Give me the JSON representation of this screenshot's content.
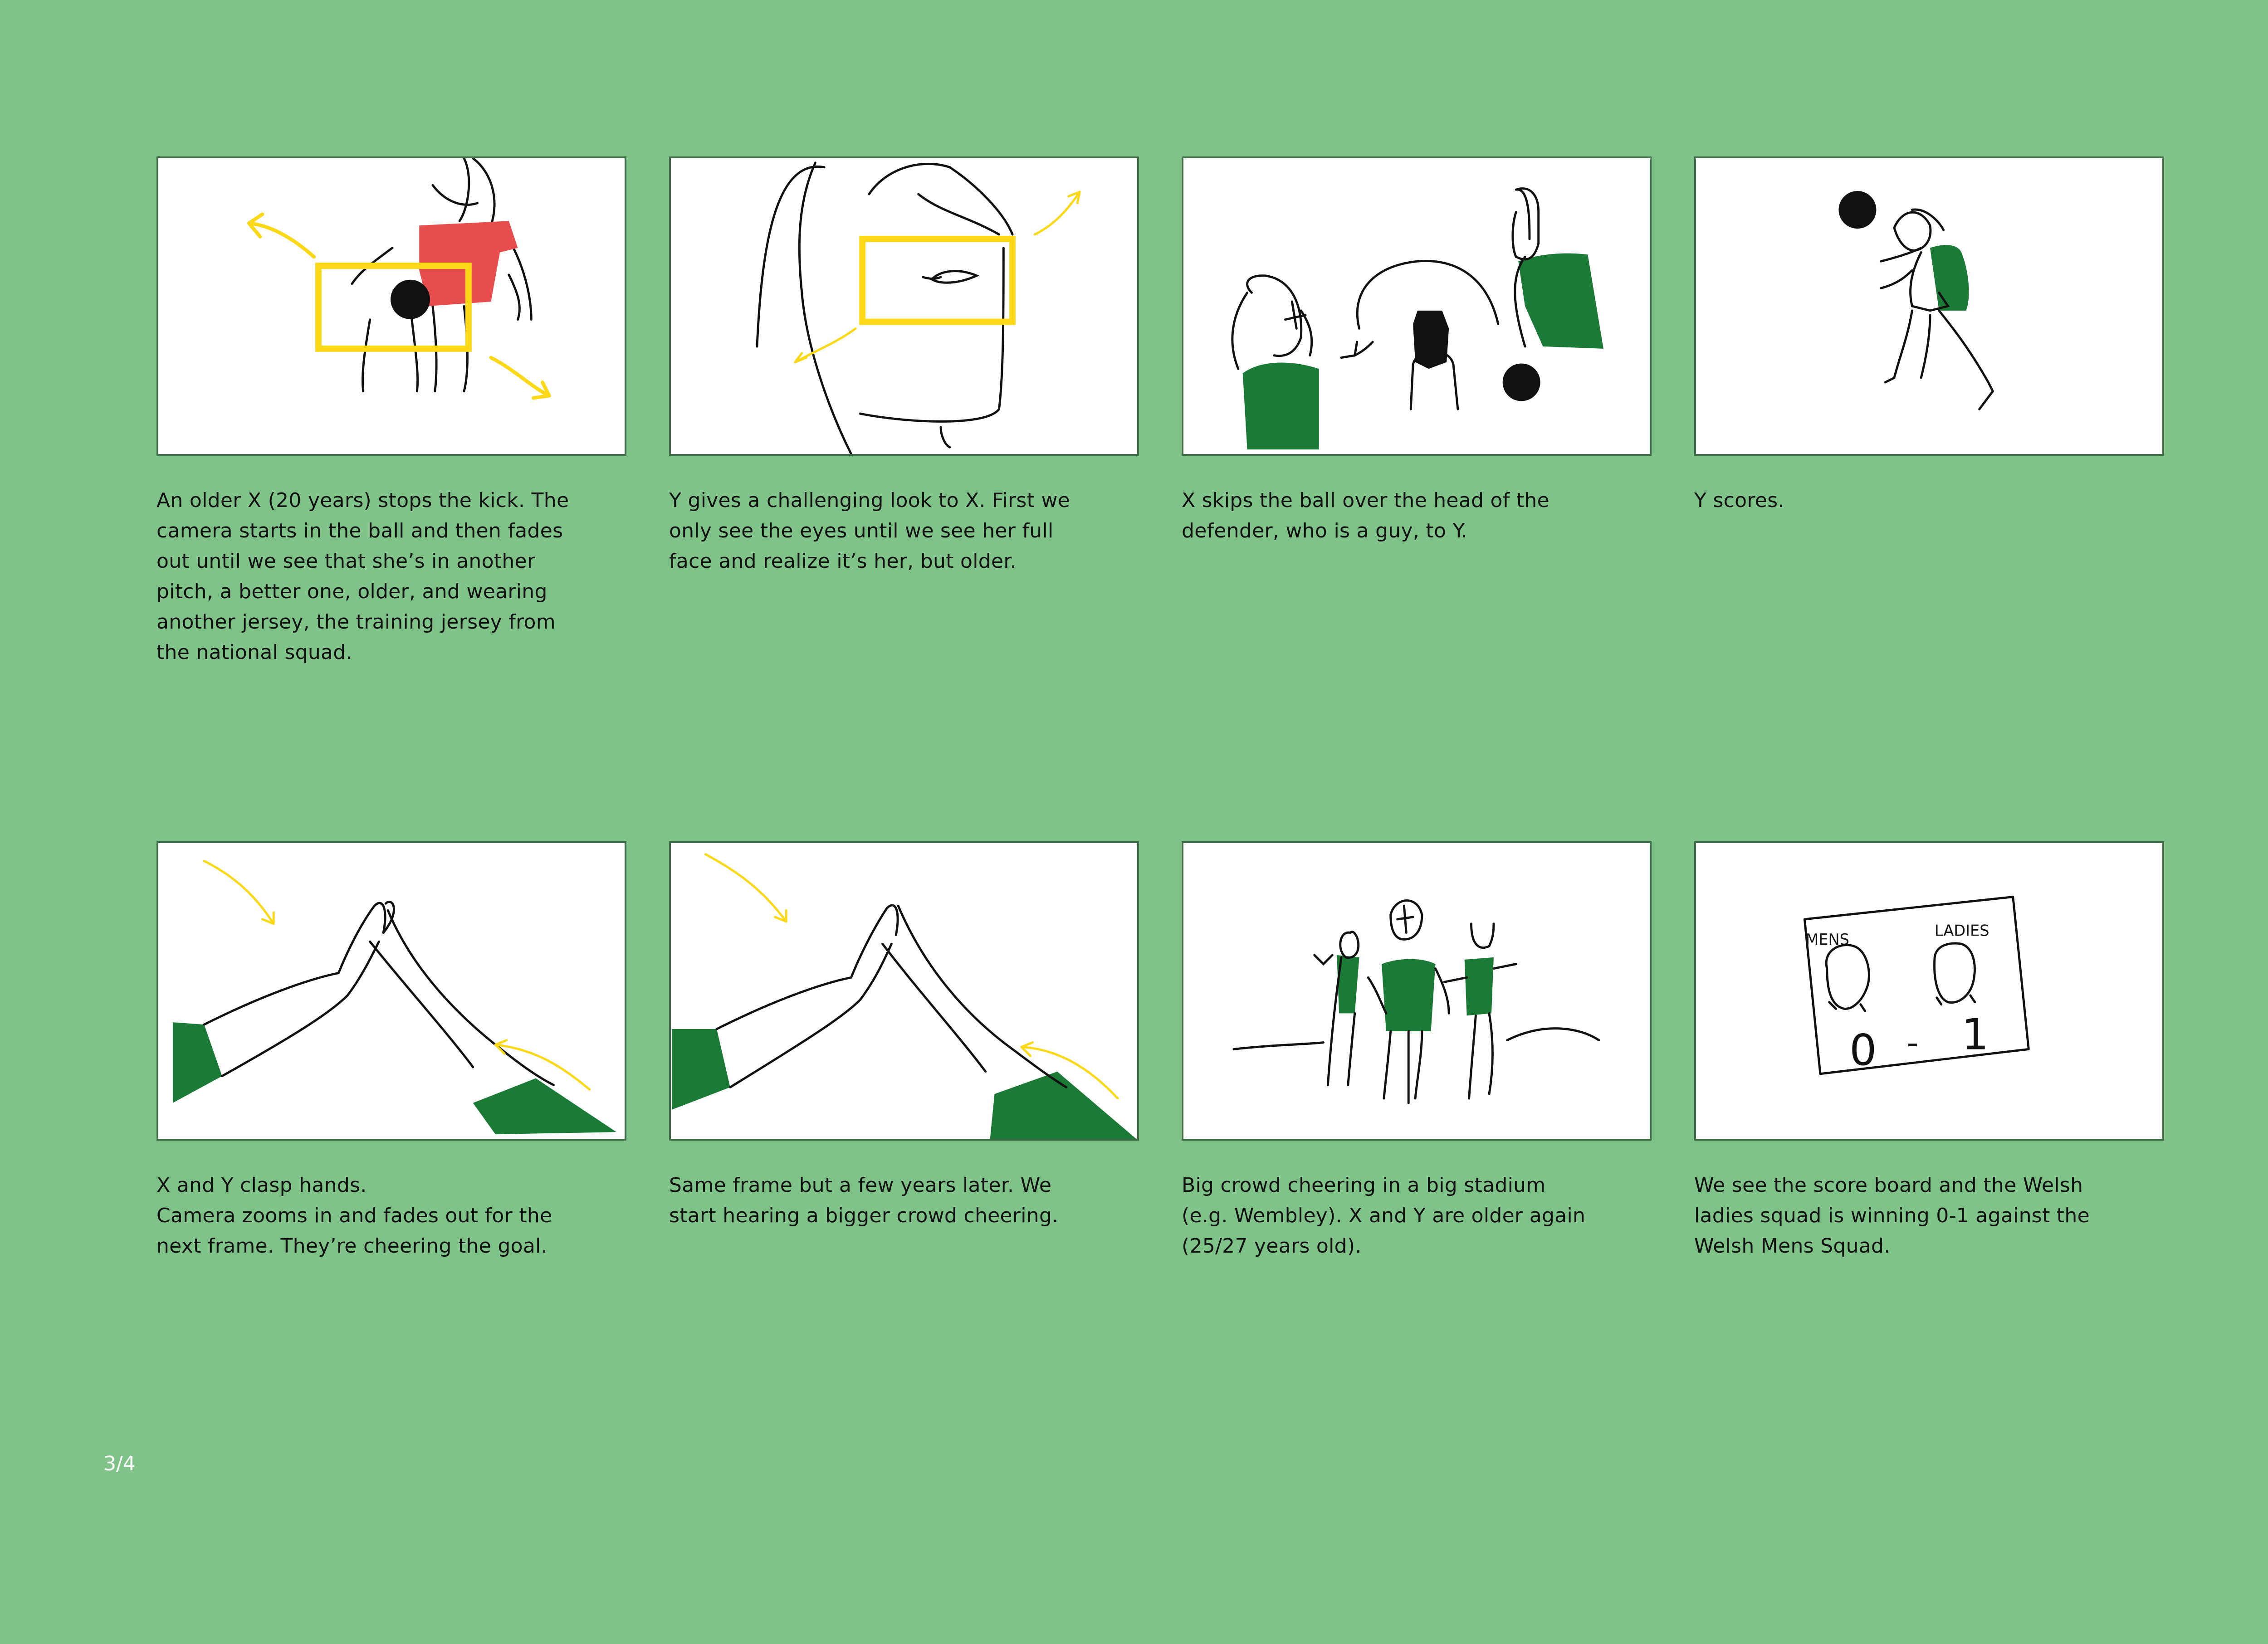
{
  "colors": {
    "background": "#7fc388",
    "frame_border": "#3f6b48",
    "accent_yellow": "#fcd816",
    "jersey_red": "#e84d4d",
    "jersey_green": "#1a7a36"
  },
  "panels": [
    {
      "caption": "An older X (20 years) stops the kick. The\ncamera starts in the ball and then fades\nout until we see that she’s in another\npitch, a better one, older, and wearing\nanother jersey, the training jersey from\nthe national squad."
    },
    {
      "caption": "Y gives a challenging look to X. First we\nonly see the eyes until we see her full\nface and realize it’s her, but older."
    },
    {
      "caption": "X skips the ball over the head of the\ndefender, who is a guy, to Y."
    },
    {
      "caption": "Y scores."
    },
    {
      "caption": "X and Y clasp hands.\nCamera zooms in and fades out for the\nnext frame. They’re cheering the goal."
    },
    {
      "caption": "Same frame but a few years later. We\nstart hearing a bigger crowd cheering."
    },
    {
      "caption": "Big crowd cheering in a big stadium\n(e.g. Wembley). X and Y are older again\n(25/27 years old)."
    },
    {
      "caption": "We see the score board and the Welsh\nladies squad is winning 0-1 against the\nWelsh Mens Squad."
    }
  ],
  "scoreboard": {
    "left_label": "MENS",
    "right_label": "LADIES",
    "left_score": "0",
    "separator": "-",
    "right_score": "1"
  },
  "page_number": "3/4"
}
